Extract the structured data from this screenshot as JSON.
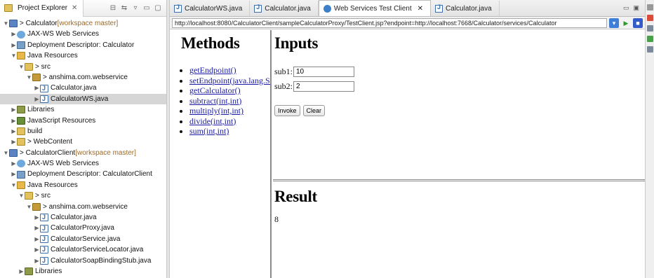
{
  "project_explorer": {
    "tab_label": "Project Explorer",
    "close_glyph": "✕",
    "tree": [
      {
        "indent": 0,
        "arrow": "▼",
        "icon": "ico-proj",
        "label": "> Calculator",
        "suffix": " [workspace master]"
      },
      {
        "indent": 1,
        "arrow": "▶",
        "icon": "ico-jax",
        "label": "JAX-WS Web Services",
        "suffix": ""
      },
      {
        "indent": 1,
        "arrow": "▶",
        "icon": "ico-dd",
        "label": "Deployment Descriptor: Calculator",
        "suffix": ""
      },
      {
        "indent": 1,
        "arrow": "▼",
        "icon": "ico-jres",
        "label": "Java Resources",
        "suffix": ""
      },
      {
        "indent": 2,
        "arrow": "▼",
        "icon": "ico-fold",
        "label": "> src",
        "suffix": ""
      },
      {
        "indent": 3,
        "arrow": "▼",
        "icon": "ico-pkg",
        "label": "> anshima.com.webservice",
        "suffix": ""
      },
      {
        "indent": 4,
        "arrow": "▶",
        "icon": "ico-j",
        "label": "Calculator.java",
        "suffix": ""
      },
      {
        "indent": 4,
        "arrow": "▶",
        "icon": "ico-j",
        "label": "CalculatorWS.java",
        "suffix": "",
        "selected": true
      },
      {
        "indent": 1,
        "arrow": "▶",
        "icon": "ico-lib",
        "label": "Libraries",
        "suffix": ""
      },
      {
        "indent": 1,
        "arrow": "▶",
        "icon": "ico-js",
        "label": "JavaScript Resources",
        "suffix": ""
      },
      {
        "indent": 1,
        "arrow": "▶",
        "icon": "ico-fold",
        "label": "build",
        "suffix": ""
      },
      {
        "indent": 1,
        "arrow": "▶",
        "icon": "ico-web",
        "label": "> WebContent",
        "suffix": ""
      },
      {
        "indent": 0,
        "arrow": "▼",
        "icon": "ico-proj",
        "label": "> CalculatorClient",
        "suffix": " [workspace master]"
      },
      {
        "indent": 1,
        "arrow": "▶",
        "icon": "ico-jax",
        "label": "JAX-WS Web Services",
        "suffix": ""
      },
      {
        "indent": 1,
        "arrow": "▶",
        "icon": "ico-dd",
        "label": "Deployment Descriptor: CalculatorClient",
        "suffix": ""
      },
      {
        "indent": 1,
        "arrow": "▼",
        "icon": "ico-jres",
        "label": "Java Resources",
        "suffix": ""
      },
      {
        "indent": 2,
        "arrow": "▼",
        "icon": "ico-fold",
        "label": "> src",
        "suffix": ""
      },
      {
        "indent": 3,
        "arrow": "▼",
        "icon": "ico-pkg",
        "label": "> anshima.com.webservice",
        "suffix": ""
      },
      {
        "indent": 4,
        "arrow": "▶",
        "icon": "ico-j",
        "label": "Calculator.java",
        "suffix": ""
      },
      {
        "indent": 4,
        "arrow": "▶",
        "icon": "ico-j",
        "label": "CalculatorProxy.java",
        "suffix": ""
      },
      {
        "indent": 4,
        "arrow": "▶",
        "icon": "ico-j",
        "label": "CalculatorService.java",
        "suffix": ""
      },
      {
        "indent": 4,
        "arrow": "▶",
        "icon": "ico-j",
        "label": "CalculatorServiceLocator.java",
        "suffix": ""
      },
      {
        "indent": 4,
        "arrow": "▶",
        "icon": "ico-j",
        "label": "CalculatorSoapBindingStub.java",
        "suffix": ""
      },
      {
        "indent": 2,
        "arrow": "▶",
        "icon": "ico-lib",
        "label": "Libraries",
        "suffix": ""
      },
      {
        "indent": 1,
        "arrow": "▶",
        "icon": "ico-js",
        "label": "JavaScript Resources",
        "suffix": ""
      }
    ]
  },
  "editor": {
    "tabs": [
      {
        "label": "CalculatorWS.java",
        "icon": "java-file-icon"
      },
      {
        "label": "Calculator.java",
        "icon": "java-file-icon"
      },
      {
        "label": "Web Services Test Client",
        "icon": "globe-icon",
        "active": true,
        "close": "✕"
      },
      {
        "label": "Calculator.java",
        "icon": "java-file-icon"
      }
    ],
    "url": "http://localhost:8080/CalculatorClient/sampleCalculatorProxy/TestClient.jsp?endpoint=http://localhost:7668/Calculator/services/Calculator"
  },
  "methods": {
    "heading": "Methods",
    "items": [
      "getEndpoint()",
      "setEndpoint(java.lang.String)",
      "getCalculator()",
      "subtract(int,int)",
      "multiply(int,int)",
      "divide(int,int)",
      "sum(int,int)"
    ]
  },
  "inputs": {
    "heading": "Inputs",
    "sub1_label": "sub1:",
    "sub1_value": "10",
    "sub2_label": "sub2:",
    "sub2_value": "2",
    "invoke_label": "Invoke",
    "clear_label": "Clear"
  },
  "result": {
    "heading": "Result",
    "value": "8"
  }
}
